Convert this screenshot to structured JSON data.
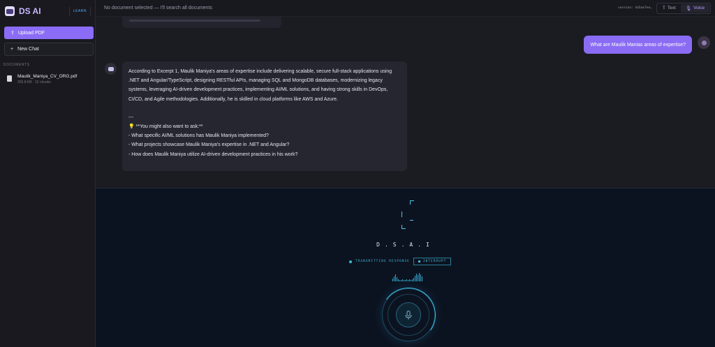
{
  "sidebar": {
    "app_title": "DS AI",
    "badge": "LEARN",
    "upload_label": "Upload PDF",
    "new_chat_label": "New Chat",
    "documents_heading": "DOCUMENTS",
    "documents": [
      {
        "name": "Maulik_Maniya_CV_ORG.pdf",
        "meta": "255.8 KB · 12 chunks"
      }
    ]
  },
  "topbar": {
    "status": "No document selected — I'll search all documents",
    "session": "session: 4a5ae7ee…",
    "mode_text": "Text",
    "mode_voice": "Voice",
    "active_mode": "Voice"
  },
  "chat": {
    "user_message": "What are Maulik Manias areas of expertise?",
    "bot_message": {
      "answer": "According to Excerpt 1, Maulik Maniya's areas of expertise include delivering scalable, secure full-stack applications using .NET and Angular/TypeScript, designing RESTful APIs, managing SQL and MongoDB databases, modernizing legacy systems, leveraging AI-driven development practices, implementing AI/ML solutions, and having strong skills in DevOps, CI/CD, and Agile methodologies. Additionally, he is skilled in cloud platforms like AWS and Azure.",
      "separator": "---",
      "suggest_heading": "💡 **You might also want to ask:**",
      "suggestions": [
        "- What specific AI/ML solutions has Maulik Maniya implemented?",
        "- What projects showcase Maulik Maniya's expertise in .NET and Angular?",
        "- How does Maulik Maniya utilize AI-driven development practices in his work?"
      ]
    }
  },
  "voice_panel": {
    "title": "D.S.A.I",
    "transmitting": "TRANSMITTING RESPONSE",
    "interrupt": "INTERRUPT",
    "accent_color": "#3fb6d6"
  }
}
